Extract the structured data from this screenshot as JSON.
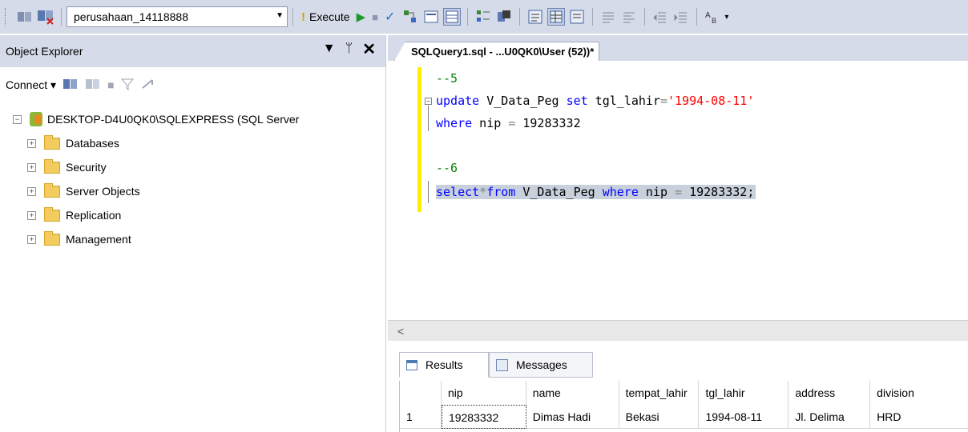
{
  "toolbar": {
    "database": "perusahaan_14118888",
    "execute_label": "Execute",
    "icons": [
      "connect-icon",
      "change-connection-icon",
      "play-icon",
      "stop-icon",
      "parse-check-icon",
      "estimated-plan-icon",
      "query-options-icon",
      "results-to-grid-icon",
      "results-to-text-icon",
      "comment-icon",
      "uncomment-icon",
      "indent-icon",
      "outdent-icon",
      "specify-values-icon"
    ]
  },
  "object_explorer": {
    "title": "Object Explorer",
    "connect_label": "Connect",
    "server": "DESKTOP-D4U0QK0\\SQLEXPRESS (SQL Server",
    "folders": [
      "Databases",
      "Security",
      "Server Objects",
      "Replication",
      "Management"
    ]
  },
  "editor": {
    "tab_title": "SQLQuery1.sql - ...U0QK0\\User (52))*",
    "lines": {
      "l1": "--5",
      "l2_kw1": "update",
      "l2_mid": " V_Data_Peg ",
      "l2_kw2": "set",
      "l2_mid2": " tgl_lahir",
      "l2_op": "=",
      "l2_str": "'1994-08-11'",
      "l3_kw": "where",
      "l3_rest": " nip ",
      "l3_op": "=",
      "l3_val": " 19283332",
      "l5": "--6",
      "l6_kw1": "select",
      "l6_op": "*",
      "l6_kw2": "from",
      "l6_mid": " V_Data_Peg ",
      "l6_kw3": "where",
      "l6_rest": " nip ",
      "l6_op2": "=",
      "l6_val": " 19283332;"
    }
  },
  "results": {
    "tabs": [
      "Results",
      "Messages"
    ],
    "columns": [
      "nip",
      "name",
      "tempat_lahir",
      "tgl_lahir",
      "address",
      "division"
    ],
    "rows": [
      {
        "index": "1",
        "nip": "19283332",
        "name": "Dimas Hadi",
        "tempat_lahir": "Bekasi",
        "tgl_lahir": "1994-08-11",
        "address": "Jl. Delima",
        "division": "HRD"
      }
    ]
  },
  "colors": {
    "toolbar_bg": "#d6dbe9",
    "keyword": "#0000ff",
    "string": "#ff0000",
    "comment": "#008000",
    "selection": "#c7d0db"
  }
}
